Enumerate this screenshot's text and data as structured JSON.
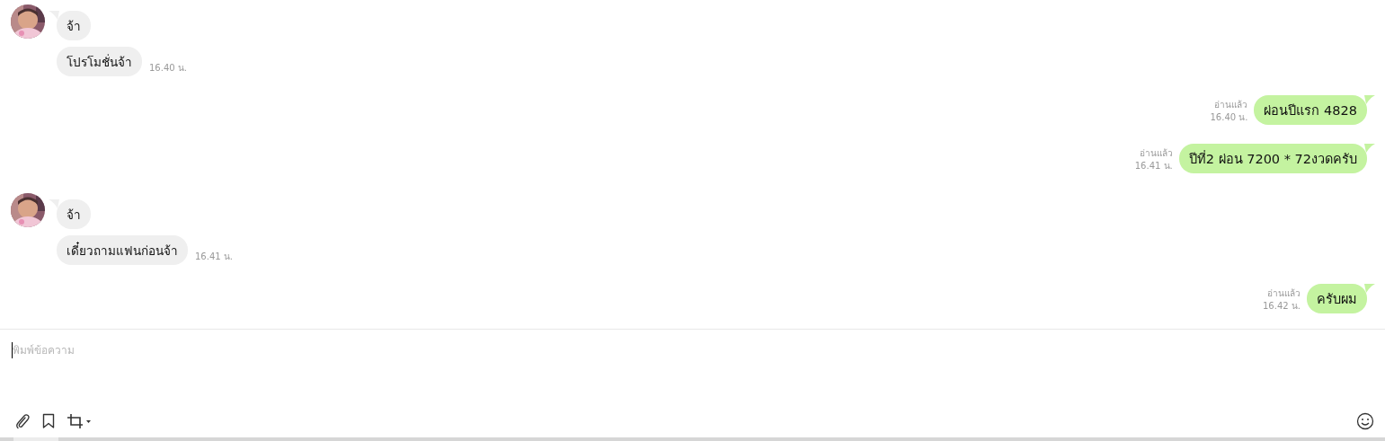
{
  "messages": [
    {
      "kind": "incoming",
      "avatar": true,
      "text": "จ้า"
    },
    {
      "kind": "incoming",
      "avatar": false,
      "text": "โปรโมชั่นจ้า",
      "time": "16.40 น."
    },
    {
      "kind": "outgoing",
      "text": "ผ่อนปีแรก 4828",
      "read": "อ่านแล้ว",
      "time": "16.40 น."
    },
    {
      "kind": "outgoing",
      "text": "ปีที่2 ผ่อน 7200 * 72งวดครับ",
      "read": "อ่านแล้ว",
      "time": "16.41 น."
    },
    {
      "kind": "incoming",
      "avatar": true,
      "text": "จ้า"
    },
    {
      "kind": "incoming",
      "avatar": false,
      "text": "เดี๋ยวถามแฟนก่อนจ้า",
      "time": "16.41 น."
    },
    {
      "kind": "outgoing",
      "text": "ครับผม",
      "read": "อ่านแล้ว",
      "time": "16.42 น."
    }
  ],
  "composer": {
    "placeholder": "พิมพ์ข้อความ"
  }
}
